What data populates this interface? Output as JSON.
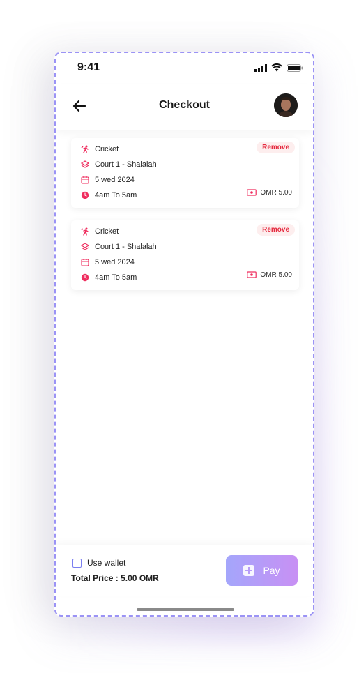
{
  "status_bar": {
    "time": "9:41"
  },
  "header": {
    "title": "Checkout"
  },
  "bookings": [
    {
      "sport": "Cricket",
      "court": "Court 1 - Shalalah",
      "date": "5 wed 2024",
      "time": "4am To 5am",
      "price": "OMR 5.00",
      "remove_label": "Remove"
    },
    {
      "sport": "Cricket",
      "court": "Court 1 - Shalalah",
      "date": "5 wed 2024",
      "time": "4am To 5am",
      "price": "OMR 5.00",
      "remove_label": "Remove"
    }
  ],
  "footer": {
    "wallet_label": "Use wallet",
    "wallet_checked": false,
    "total_label": "Total Price : 5.00 OMR",
    "pay_label": "Pay"
  },
  "colors": {
    "accent": "#e5283d",
    "icon": "#ef2d5e",
    "checkbox": "#7b7ff0",
    "pay_gradient_start": "#a4a6fb",
    "pay_gradient_end": "#c890f4"
  },
  "icons": [
    "back-arrow-icon",
    "cellular-signal-icon",
    "wifi-icon",
    "battery-icon",
    "cricket-icon",
    "court-icon",
    "calendar-icon",
    "clock-icon",
    "money-icon",
    "plus-icon"
  ]
}
